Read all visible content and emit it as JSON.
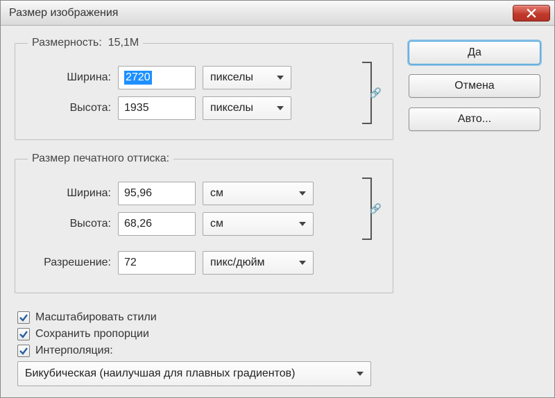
{
  "window": {
    "title": "Размер изображения"
  },
  "buttons": {
    "ok": "Да",
    "cancel": "Отмена",
    "auto": "Авто..."
  },
  "dims": {
    "legend_prefix": "Размерность:",
    "filesize": "15,1M",
    "width_label": "Ширина:",
    "height_label": "Высота:",
    "width_value": "2720",
    "height_value": "1935",
    "unit": "пикселы"
  },
  "print": {
    "legend": "Размер печатного оттиска:",
    "width_label": "Ширина:",
    "height_label": "Высота:",
    "res_label": "Разрешение:",
    "width_value": "95,96",
    "height_value": "68,26",
    "res_value": "72",
    "unit_cm": "см",
    "unit_res": "пикс/дюйм"
  },
  "checks": {
    "scale_styles": "Масштабировать стили",
    "constrain": "Сохранить пропорции",
    "interp_label": "Интерполяция:"
  },
  "interp": {
    "method": "Бикубическая (наилучшая для плавных градиентов)"
  }
}
